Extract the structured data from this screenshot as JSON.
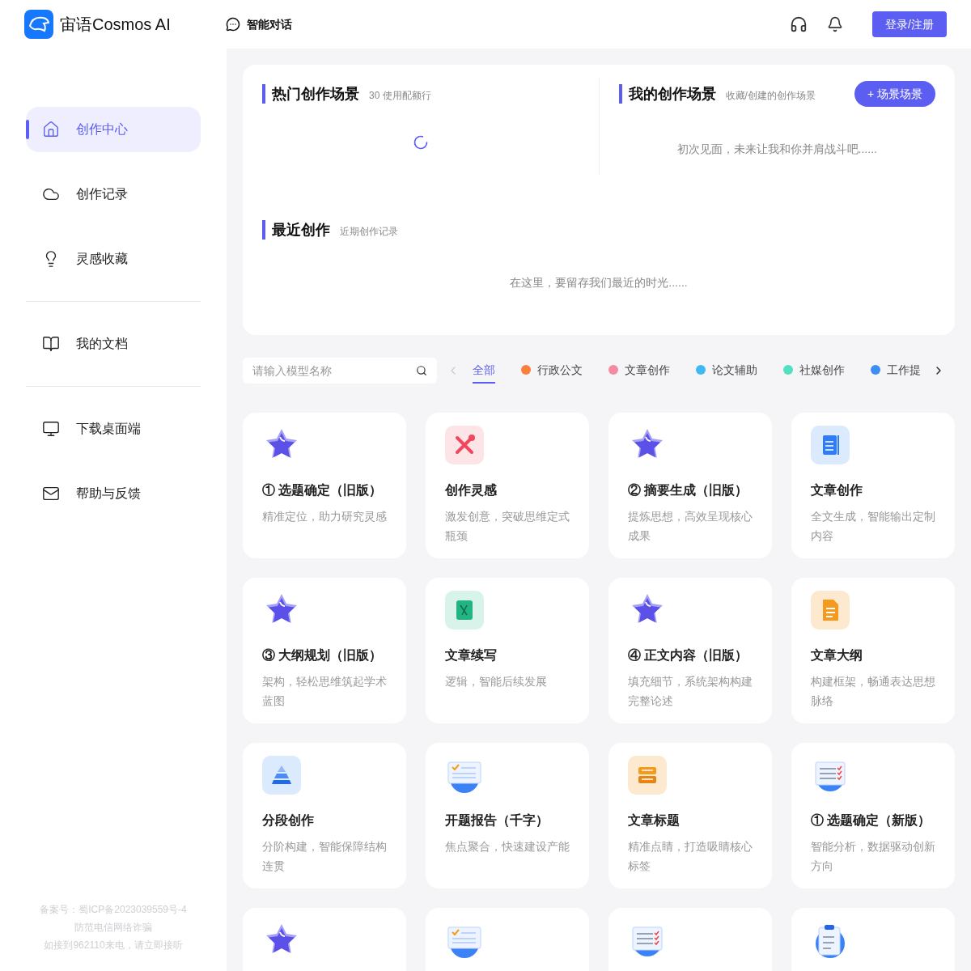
{
  "header": {
    "brand": "宙语Cosmos AI",
    "nav": [
      {
        "label": "智能对话",
        "selected": false
      }
    ],
    "login_button": "登录/注册"
  },
  "sidebar": {
    "groups": [
      [
        {
          "label": "创作中心",
          "selected": true
        },
        {
          "label": "创作记录",
          "selected": false
        },
        {
          "label": "灵感收藏",
          "selected": false
        }
      ],
      [
        {
          "label": "我的文档",
          "selected": false
        }
      ],
      [
        {
          "label": "下载桌面端",
          "selected": false
        },
        {
          "label": "帮助与反馈",
          "selected": false
        }
      ]
    ],
    "footer": [
      "备案号：蜀ICP备2023039559号-4",
      "防范电信网络诈骗",
      "如接到962110来电，请立即接听"
    ]
  },
  "hot_scenes": {
    "title": "热门创作场景",
    "subtitle": "30 使用配额行"
  },
  "my_scenes": {
    "title": "我的创作场景",
    "subtitle": "收藏/创建的创作场景",
    "button": "+ 场景场景",
    "empty": "初次见面，未来让我和你并肩战斗吧......"
  },
  "recent": {
    "title": "最近创作",
    "subtitle": "近期创作记录",
    "empty": "在这里，要留存我们最近的时光......"
  },
  "search": {
    "placeholder": "请输入模型名称"
  },
  "categories": [
    {
      "label": "全部",
      "selected": true
    },
    {
      "label": "行政公文",
      "selected": false,
      "color": "#f97f3c"
    },
    {
      "label": "文章创作",
      "selected": false,
      "color": "#f58aa0"
    },
    {
      "label": "论文辅助",
      "selected": false,
      "color": "#3fb8f5"
    },
    {
      "label": "社媒创作",
      "selected": false,
      "color": "#52e0bf"
    },
    {
      "label": "工作提",
      "selected": false,
      "color": "#3d8ef2"
    }
  ],
  "cards": [
    {
      "title": "① 选题确定（旧版）",
      "description": "精准定位，助力研究灵感"
    },
    {
      "title": "创作灵感",
      "description": "激发创意，突破思维定式瓶颈"
    },
    {
      "title": "② 摘要生成（旧版）",
      "description": "提炼思想，高效呈现核心成果"
    },
    {
      "title": "文章创作",
      "description": "全文生成，智能输出定制内容"
    },
    {
      "title": "③ 大纲规划（旧版）",
      "description": "架构，轻松思维筑起学术蓝图"
    },
    {
      "title": "文章续写",
      "description": "逻辑，智能后续发展"
    },
    {
      "title": "④ 正文内容（旧版）",
      "description": "填充细节，系统架构构建完整论述"
    },
    {
      "title": "文章大纲",
      "description": "构建框架，畅通表达思想脉络"
    },
    {
      "title": "分段创作",
      "description": "分阶构建，智能保障结构连贯"
    },
    {
      "title": "开题报告（千字）",
      "description": "焦点聚合，快速建设产能"
    },
    {
      "title": "文章标题",
      "description": "精准点睛，打造吸睛核心标签"
    },
    {
      "title": "① 选题确定（新版）",
      "description": "智能分析，数据驱动创新方向"
    }
  ]
}
